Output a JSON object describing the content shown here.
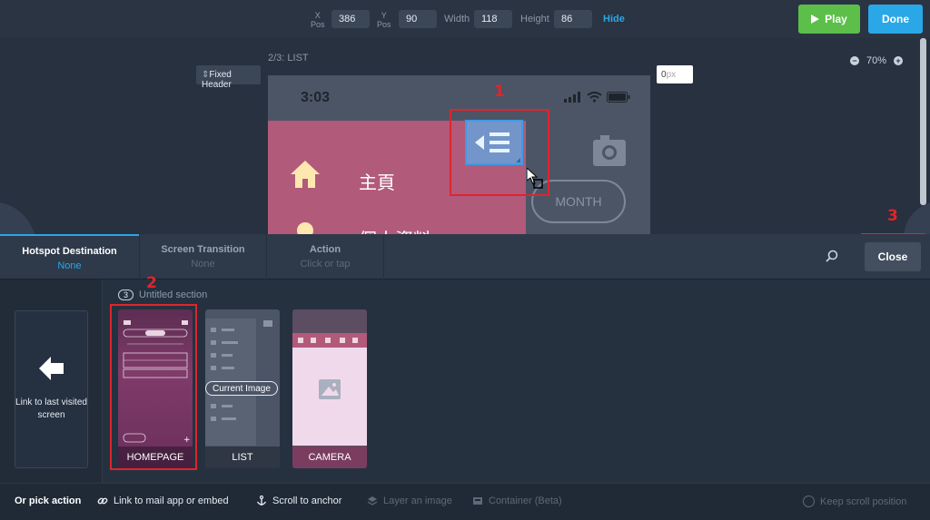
{
  "toolbar": {
    "x_label": "X",
    "x_sub": "Pos",
    "x_value": "386",
    "y_label": "Y",
    "y_sub": "Pos",
    "y_value": "90",
    "width_label": "Width",
    "width_value": "118",
    "height_label": "Height",
    "height_value": "86",
    "hide_label": "Hide",
    "play_label": "Play",
    "done_label": "Done"
  },
  "canvas": {
    "screen_title": "2/3: LIST",
    "fixed_header_label": "Fixed Header",
    "fixed_header_value": "0",
    "fixed_header_unit": "px",
    "zoom_level": "70%",
    "phone": {
      "time": "3:03",
      "menu_home": "主頁",
      "menu_profile": "個人資料",
      "month_label": "MONTH"
    }
  },
  "annotations": {
    "one": "1",
    "two": "2",
    "three": "3"
  },
  "tabs": [
    {
      "title": "Hotspot Destination",
      "subtitle": "None"
    },
    {
      "title": "Screen Transition",
      "subtitle": "None"
    },
    {
      "title": "Action",
      "subtitle": "Click or tap"
    }
  ],
  "close_label": "Close",
  "panel": {
    "link_last_label": "Link to last visited screen",
    "section_count": "3",
    "section_name": "Untitled section",
    "screens": [
      {
        "name": "HOMEPAGE"
      },
      {
        "name": "LIST"
      },
      {
        "name": "CAMERA"
      }
    ],
    "current_image_label": "Current Image"
  },
  "actions": {
    "pick_label": "Or pick action",
    "link_mail": "Link to mail app or embed",
    "scroll_anchor": "Scroll to anchor",
    "layer_image": "Layer an image",
    "container": "Container (Beta)",
    "keep_scroll": "Keep scroll position"
  },
  "colors": {
    "accent_blue": "#29a8e6",
    "play_green": "#5bbf4a",
    "annotation_red": "#e0242c",
    "menu_pink": "#b25a7a"
  }
}
